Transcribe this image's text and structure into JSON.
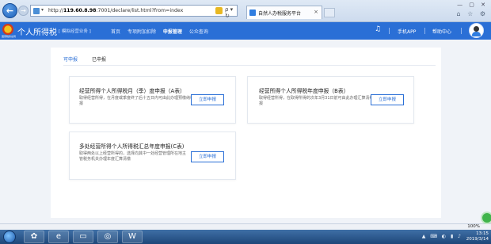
{
  "browser": {
    "url_prefix": "http://",
    "url_host": "119.60.8.98",
    "url_rest": ":7001/declare/list.html?from=index",
    "tab_title": "自然人办税服务平台",
    "tab_close": "×",
    "back_glyph": "←",
    "fwd_glyph": "→",
    "window_controls": "— ▢ ✕",
    "toolbar_icons": "⌂ ☆ ⚙",
    "search_glyph": "ρ ▾ ↻"
  },
  "header": {
    "emblem_text": "国家税务总局",
    "title": "个人所得税",
    "subtitle": "[ 模拟经营业务 ]",
    "nav": [
      "首页",
      "专项附加扣除",
      "申报管理",
      "公众查询"
    ],
    "active_nav": "申报管理",
    "mobile_app": "手机APP",
    "help_center": "帮助中心"
  },
  "tabs": {
    "pending": "可申报",
    "done": "已申报"
  },
  "cards": [
    {
      "title": "经营所得个人所得税月（季）度申报（A表）",
      "desc": "取得经营所得，在月度或季度终了后十五日内可由此办理预缴纳税申报",
      "button": "立即申报"
    },
    {
      "title": "经营所得个人所得税年度申报（B表）",
      "desc": "取得经营所得，在取得所得的次年3月31日前可由此办理汇算清缴申报",
      "button": "立即申报"
    },
    {
      "title": "多处经营所得个人所得税汇总年度申报(C表)",
      "desc": "取得两处以上经营所得的，选择向其中一处经营管理所在地主管税务机关办理年度汇算清缴",
      "button": "立即申报"
    }
  ],
  "statusbar": {
    "zoom": "100%"
  },
  "taskbar": {
    "tray_icons": "▲ ⌨ ◐ ▮ ♪",
    "time": "13:15",
    "date": "2019/3/14"
  }
}
